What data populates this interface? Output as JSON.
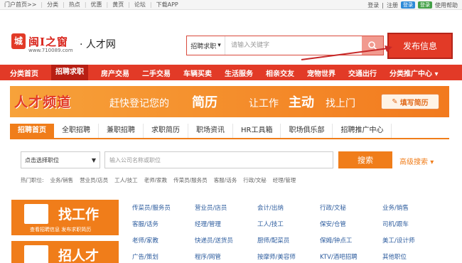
{
  "topbar": {
    "left": [
      "门户首页>>",
      "分类",
      "热点",
      "优惠",
      "黄页",
      "论坛",
      "下载APP"
    ],
    "right": {
      "login": "登录",
      "register": "注册",
      "qq_login": "登录",
      "wechat_login": "登录",
      "help": "使用帮助"
    }
  },
  "header": {
    "logo_mark": "城",
    "logo_name": "闽Ⅰ之窗",
    "logo_url": "www.710089.com",
    "logo_sub": "· 人才网",
    "search_category": "招聘求职",
    "search_placeholder": "请输入关键字",
    "publish": "发布信息"
  },
  "nav": [
    "分类首页",
    "招聘求职",
    "房产交易",
    "二手交易",
    "车辆买卖",
    "生活服务",
    "相亲交友",
    "宠物世界",
    "交通出行",
    "分类推广中心"
  ],
  "nav_active": 1,
  "banner": {
    "logo": "人才频道",
    "t1": "赶快登记您的",
    "big1": "简历",
    "t2": "让工作",
    "big2": "主动",
    "t3": "找上门",
    "button": "填写简历"
  },
  "subtabs": [
    "招聘首页",
    "全职招聘",
    "兼职招聘",
    "求职简历",
    "职场资讯",
    "HR工具箱",
    "职场俱乐部",
    "招聘推广中心"
  ],
  "jobsearch": {
    "select": "点击选择职位",
    "input_placeholder": "输入公司名称或职位",
    "button": "搜索",
    "advanced": "高级搜索",
    "hot_label": "热门职位:",
    "hot": [
      "业务/销售",
      "营业员/店员",
      "工人/技工",
      "老师/家教",
      "传菜员/服务员",
      "客服/话务",
      "行政/文秘",
      "经理/管理"
    ]
  },
  "cards": {
    "find_job": "找工作",
    "find_job_sub": "查看招聘信息  发布求职简历",
    "hire": "招人才"
  },
  "jobs": [
    [
      "传菜员/服务员",
      "营业员/店员",
      "会计/出纳",
      "行政/文秘",
      "业务/销售"
    ],
    [
      "客服/话务",
      "经理/管理",
      "工人/技工",
      "保安/仓管",
      "司机/跟车"
    ],
    [
      "老师/家教",
      "快递员/送货员",
      "厨师/配菜员",
      "保姆/钟点工",
      "美工/设计师"
    ],
    [
      "广告/策划",
      "程序/网管",
      "按摩师/美容师",
      "KTV/酒吧招聘",
      "其他职位"
    ]
  ],
  "colors": {
    "brand_red": "#e23a27",
    "orange": "#f07d1a",
    "link_blue": "#2d5c9e"
  }
}
